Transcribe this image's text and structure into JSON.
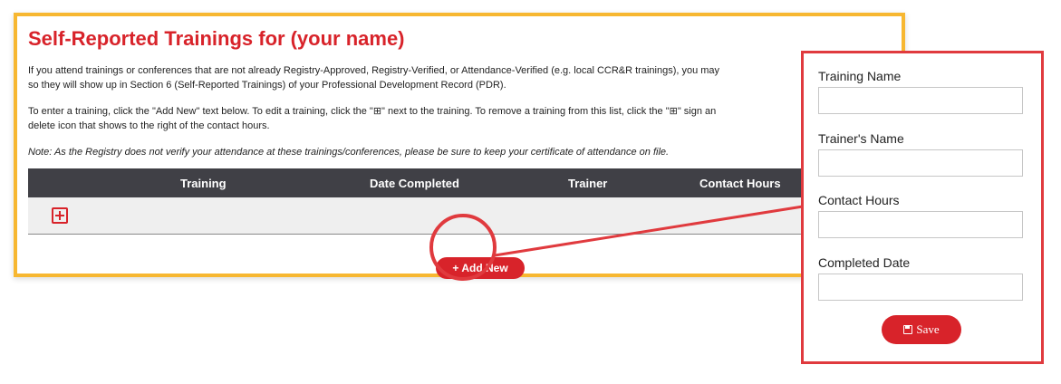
{
  "page": {
    "title_prefix": "Self-Reported Trainings for",
    "title_name": "(your name)",
    "paragraph1": "If you attend trainings or conferences that are not already Registry-Approved, Registry-Verified, or Attendance-Verified (e.g. local CCR&R trainings), you may",
    "paragraph1_line2": "so they will show up in Section 6 (Self-Reported Trainings) of your Professional Development Record (PDR).",
    "paragraph2": "To enter a training, click the \"Add New\" text below. To edit a training, click the \"⊞\" next to the training. To remove a training from this list, click the \"⊞\" sign an",
    "paragraph2_line2": "delete icon that shows to the right of the contact hours.",
    "note": "Note: As the Registry does not verify your attendance at these trainings/conferences, please be sure to keep your certificate of attendance on file."
  },
  "table": {
    "columns": [
      "Training",
      "Date Completed",
      "Trainer",
      "Contact Hours"
    ]
  },
  "add_new": {
    "plus": "+",
    "label": "Add New"
  },
  "form": {
    "fields": [
      {
        "label": "Training Name",
        "value": ""
      },
      {
        "label": "Trainer's Name",
        "value": ""
      },
      {
        "label": "Contact Hours",
        "value": ""
      },
      {
        "label": "Completed Date",
        "value": ""
      }
    ],
    "save_label": "Save",
    "save_icon": "floppy-disk-icon"
  },
  "colors": {
    "brand_red": "#d8232a",
    "highlight_yellow": "#f7b731",
    "callout_red": "#e03a3e",
    "table_header": "#404046"
  }
}
